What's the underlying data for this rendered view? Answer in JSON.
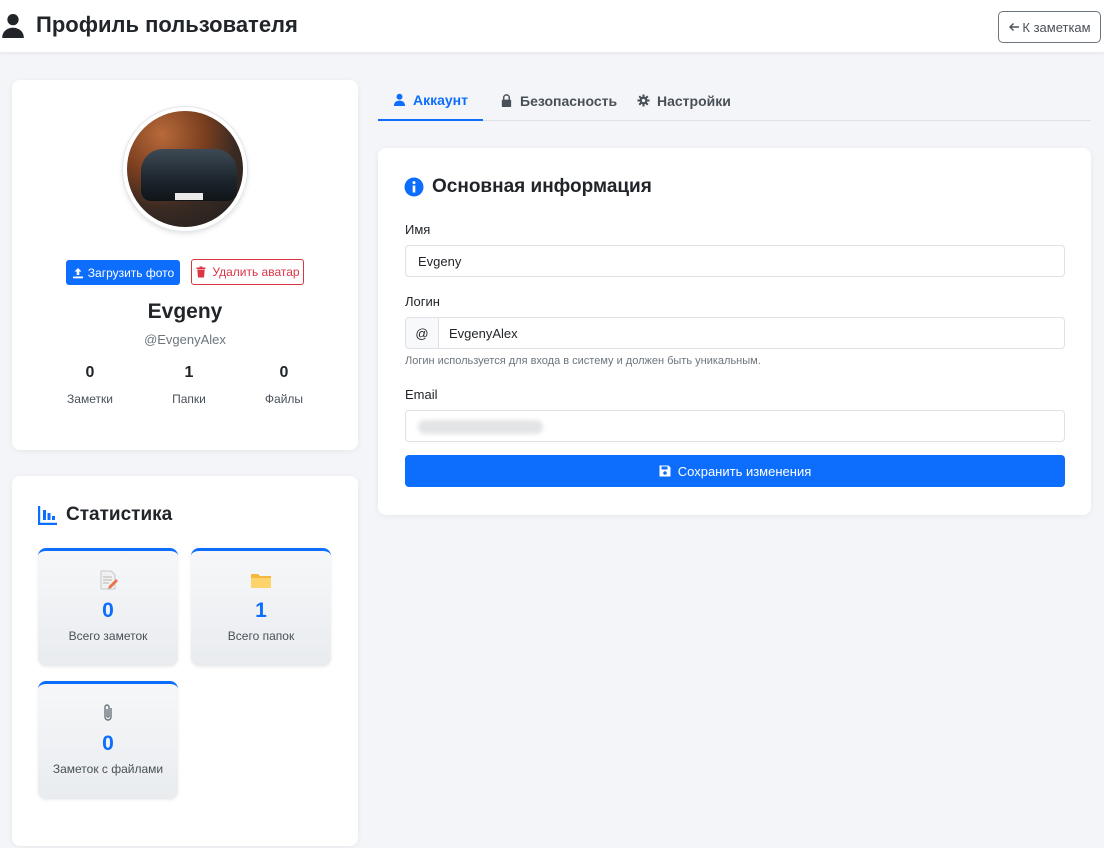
{
  "header": {
    "title": "Профиль пользователя",
    "back_label": "К заметкам"
  },
  "profile": {
    "name": "Evgeny",
    "login": "@EvgenyAlex",
    "upload_label": "Загрузить фото",
    "delete_label": "Удалить аватар",
    "stats": [
      {
        "value": "0",
        "label": "Заметки"
      },
      {
        "value": "1",
        "label": "Папки"
      },
      {
        "value": "0",
        "label": "Файлы"
      }
    ]
  },
  "statistics": {
    "title": "Статистика",
    "tiles": [
      {
        "value": "0",
        "label": "Всего заметок",
        "icon": "memo-icon"
      },
      {
        "value": "1",
        "label": "Всего папок",
        "icon": "folder-icon"
      },
      {
        "value": "0",
        "label": "Заметок с файлами",
        "icon": "paperclip-icon"
      }
    ]
  },
  "tabs": [
    {
      "label": "Аккаунт",
      "icon": "user-icon",
      "active": true
    },
    {
      "label": "Безопасность",
      "icon": "lock-icon",
      "active": false
    },
    {
      "label": "Настройки",
      "icon": "gear-icon",
      "active": false
    }
  ],
  "form": {
    "title": "Основная информация",
    "name_label": "Имя",
    "name_value": "Evgeny",
    "login_label": "Логин",
    "login_prefix": "@",
    "login_value": "EvgenyAlex",
    "login_help": "Логин используется для входа в систему и должен быть уникальным.",
    "email_label": "Email",
    "save_label": "Сохранить изменения"
  },
  "colors": {
    "accent": "#0d6efd",
    "danger": "#dc3545"
  }
}
